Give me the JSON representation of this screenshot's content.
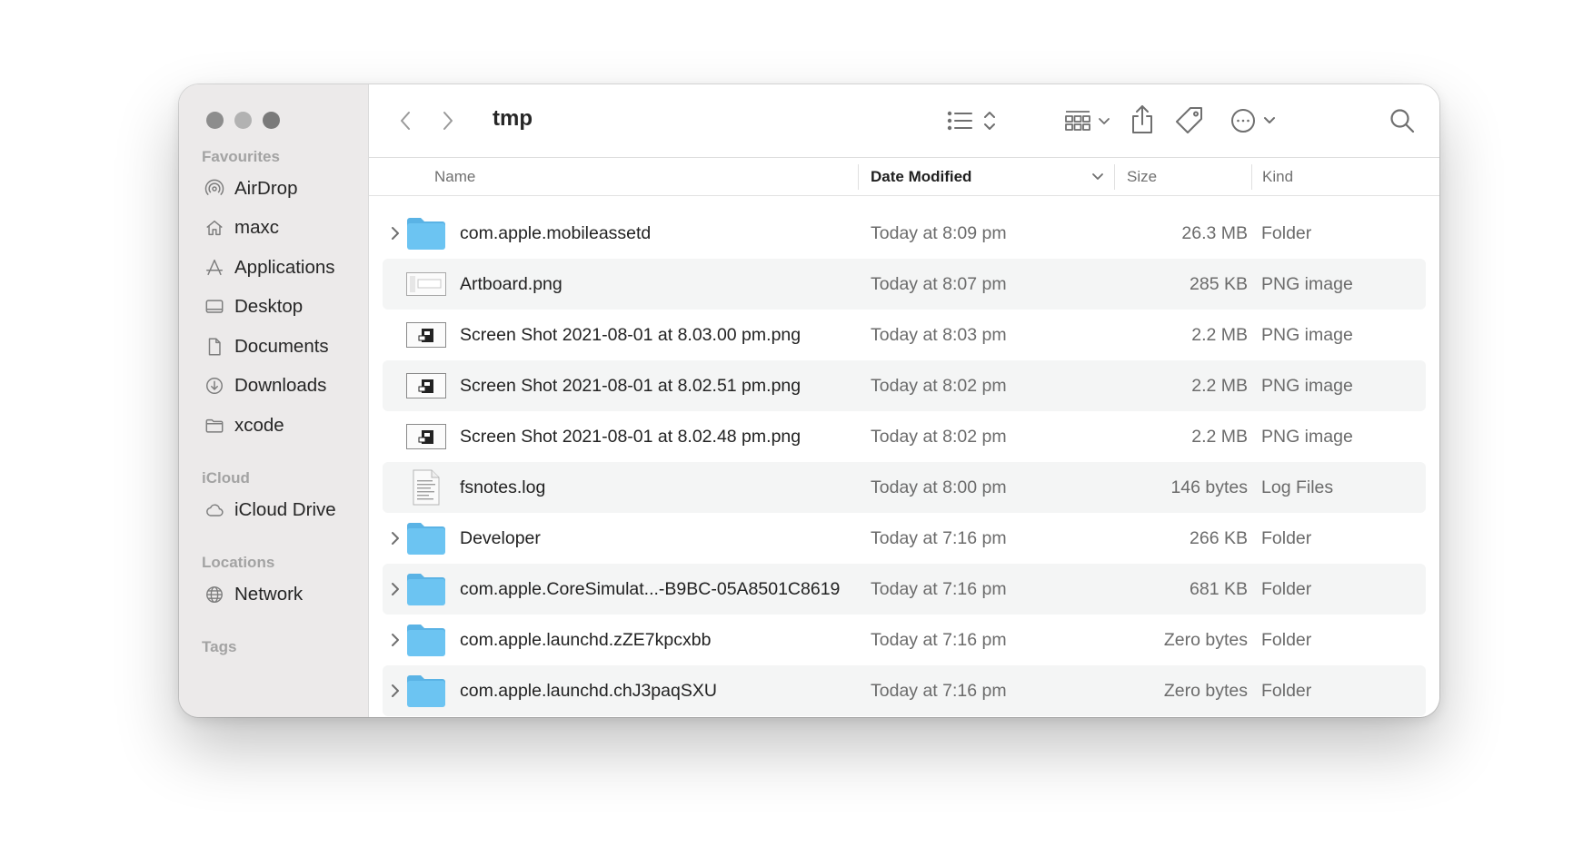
{
  "window": {
    "title": "tmp"
  },
  "sidebar": {
    "favourites_heading": "Favourites",
    "favourites": [
      {
        "label": "AirDrop",
        "icon": "airdrop-icon"
      },
      {
        "label": "maxc",
        "icon": "home-icon"
      },
      {
        "label": "Applications",
        "icon": "applications-icon"
      },
      {
        "label": "Desktop",
        "icon": "desktop-icon"
      },
      {
        "label": "Documents",
        "icon": "document-icon"
      },
      {
        "label": "Downloads",
        "icon": "downloads-icon"
      },
      {
        "label": "xcode",
        "icon": "folder-icon"
      }
    ],
    "icloud_heading": "iCloud",
    "icloud": [
      {
        "label": "iCloud Drive",
        "icon": "cloud-icon"
      }
    ],
    "locations_heading": "Locations",
    "locations": [
      {
        "label": "Network",
        "icon": "globe-icon"
      }
    ],
    "tags_heading": "Tags"
  },
  "columns": {
    "name": "Name",
    "date_modified": "Date Modified",
    "size": "Size",
    "kind": "Kind"
  },
  "files": [
    {
      "name": "com.apple.mobileassetd",
      "date": "Today at 8:09 pm",
      "size": "26.3 MB",
      "kind": "Folder",
      "type": "folder"
    },
    {
      "name": "Artboard.png",
      "date": "Today at 8:07 pm",
      "size": "285 KB",
      "kind": "PNG image",
      "type": "artboard"
    },
    {
      "name": "Screen Shot 2021-08-01 at 8.03.00 pm.png",
      "date": "Today at 8:03 pm",
      "size": "2.2 MB",
      "kind": "PNG image",
      "type": "screenshot"
    },
    {
      "name": "Screen Shot 2021-08-01 at 8.02.51 pm.png",
      "date": "Today at 8:02 pm",
      "size": "2.2 MB",
      "kind": "PNG image",
      "type": "screenshot"
    },
    {
      "name": "Screen Shot 2021-08-01 at 8.02.48 pm.png",
      "date": "Today at 8:02 pm",
      "size": "2.2 MB",
      "kind": "PNG image",
      "type": "screenshot"
    },
    {
      "name": "fsnotes.log",
      "date": "Today at 8:00 pm",
      "size": "146 bytes",
      "kind": "Log Files",
      "type": "log"
    },
    {
      "name": "Developer",
      "date": "Today at 7:16 pm",
      "size": "266 KB",
      "kind": "Folder",
      "type": "folder"
    },
    {
      "name": "com.apple.CoreSimulat...-B9BC-05A8501C8619",
      "date": "Today at 7:16 pm",
      "size": "681 KB",
      "kind": "Folder",
      "type": "folder"
    },
    {
      "name": "com.apple.launchd.zZE7kpcxbb",
      "date": "Today at 7:16 pm",
      "size": "Zero bytes",
      "kind": "Folder",
      "type": "folder"
    },
    {
      "name": "com.apple.launchd.chJ3paqSXU",
      "date": "Today at 7:16 pm",
      "size": "Zero bytes",
      "kind": "Folder",
      "type": "folder"
    }
  ],
  "colors": {
    "folder_blue": "#6cc4f2",
    "folder_tab": "#5ab3e5",
    "sidebar_bg": "#eceaea",
    "alt_row": "#f4f5f5"
  }
}
